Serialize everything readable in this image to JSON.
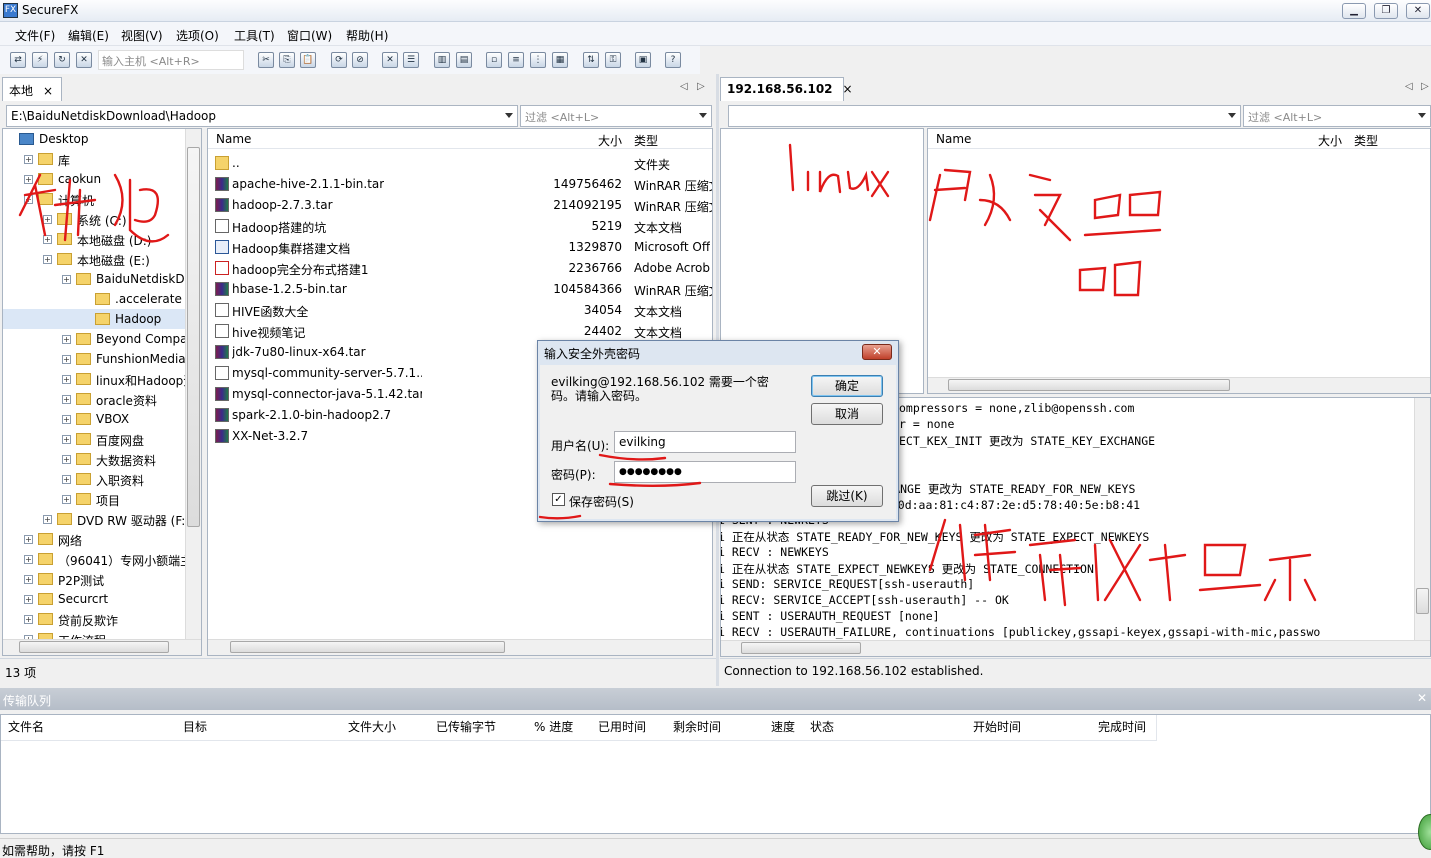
{
  "window": {
    "title": "SecureFX",
    "min": "▁",
    "max": "❐",
    "close": "✕"
  },
  "menu": [
    "文件(F)",
    "编辑(E)",
    "视图(V)",
    "选项(O)",
    "工具(T)",
    "窗口(W)",
    "帮助(H)"
  ],
  "toolbar": {
    "host_placeholder": "输入主机 <Alt+R>"
  },
  "left": {
    "tab_label": "本地",
    "tab_close": "×",
    "path": "E:\\BaiduNetdiskDownload\\Hadoop",
    "filter_placeholder": "过滤 <Alt+L>",
    "tree": [
      {
        "label": "Desktop",
        "indent": 0
      },
      {
        "label": "库",
        "indent": 1
      },
      {
        "label": "caokun",
        "indent": 1
      },
      {
        "label": "计算机",
        "indent": 1
      },
      {
        "label": "系统 (C:)",
        "indent": 2
      },
      {
        "label": "本地磁盘 (D:)",
        "indent": 2
      },
      {
        "label": "本地磁盘 (E:)",
        "indent": 2
      },
      {
        "label": "BaiduNetdiskDow",
        "indent": 3
      },
      {
        "label": ".accelerate",
        "indent": 4
      },
      {
        "label": "Hadoop",
        "indent": 4
      },
      {
        "label": "Beyond Compare",
        "indent": 3
      },
      {
        "label": "FunshionMedia",
        "indent": 3
      },
      {
        "label": "linux和Hadoop资料",
        "indent": 3
      },
      {
        "label": "oracle资料",
        "indent": 3
      },
      {
        "label": "VBOX",
        "indent": 3
      },
      {
        "label": "百度网盘",
        "indent": 3
      },
      {
        "label": "大数据资料",
        "indent": 3
      },
      {
        "label": "入职资料",
        "indent": 3
      },
      {
        "label": "项目",
        "indent": 3
      },
      {
        "label": "DVD RW 驱动器 (F:)",
        "indent": 2
      },
      {
        "label": "网络",
        "indent": 1
      },
      {
        "label": "（96041）专网小额端主机",
        "indent": 1
      },
      {
        "label": "P2P测试",
        "indent": 1
      },
      {
        "label": "Securcrt",
        "indent": 1
      },
      {
        "label": "贷前反欺诈",
        "indent": 1
      },
      {
        "label": "工作流程",
        "indent": 1
      }
    ],
    "columns": {
      "name": "Name",
      "size": "大小",
      "type": "类型"
    },
    "files": [
      {
        "name": "..",
        "size": "",
        "type": "文件夹",
        "icon": "folder"
      },
      {
        "name": "apache-hive-2.1.1-bin.tar",
        "size": "149756462",
        "type": "WinRAR 压缩文",
        "icon": "rar"
      },
      {
        "name": "hadoop-2.7.3.tar",
        "size": "214092195",
        "type": "WinRAR 压缩文",
        "icon": "rar"
      },
      {
        "name": "Hadoop搭建的坑",
        "size": "5219",
        "type": "文本文档",
        "icon": "doc"
      },
      {
        "name": "Hadoop集群搭建文档",
        "size": "1329870",
        "type": "Microsoft Off",
        "icon": "word"
      },
      {
        "name": "hadoop完全分布式搭建1",
        "size": "2236766",
        "type": "Adobe Acrob",
        "icon": "pdf"
      },
      {
        "name": "hbase-1.2.5-bin.tar",
        "size": "104584366",
        "type": "WinRAR 压缩文",
        "icon": "rar"
      },
      {
        "name": "HIVE函数大全",
        "size": "34054",
        "type": "文本文档",
        "icon": "doc"
      },
      {
        "name": "hive视频笔记",
        "size": "24402",
        "type": "文本文档",
        "icon": "doc"
      },
      {
        "name": "jdk-7u80-linux-x64.tar",
        "size": "",
        "type": "",
        "icon": "rar"
      },
      {
        "name": "mysql-community-server-5.7.1...",
        "size": "",
        "type": "",
        "icon": "doc"
      },
      {
        "name": "mysql-connector-java-5.1.42.tar",
        "size": "",
        "type": "",
        "icon": "rar"
      },
      {
        "name": "spark-2.1.0-bin-hadoop2.7",
        "size": "",
        "type": "",
        "icon": "rar"
      },
      {
        "name": "XX-Net-3.2.7",
        "size": "",
        "type": "",
        "icon": "rar"
      }
    ],
    "status": "13 项"
  },
  "right": {
    "tab_label": "192.168.56.102",
    "tab_close": "×",
    "filter_placeholder": "过滤 <Alt+L>",
    "columns": {
      "name": "Name",
      "size": "大小",
      "type": "类型"
    },
    "log": [
      "i 正在从状态 STATE_EXPECT_KEX_INIT 更改为 STATE_KEY_EXCHANGE",
      "i 正在从状态 STATE_KEY_EXCHANGE 更改为 STATE_READY_FOR_NEW_KEYS",
      "i 主机密钥指纹: 45:98:f7:56:0d:aa:81:c4:87:2e:d5:78:40:5e:b8:41",
      "i SENT : NEWKEYS",
      "i 正在从状态 STATE_READY_FOR_NEW_KEYS 更改为 STATE_EXPECT_NEWKEYS",
      "i RECV : NEWKEYS",
      "i 正在从状态 STATE_EXPECT_NEWKEYS 更改为 STATE_CONNECTION",
      "i SEND: SERVICE_REQUEST[ssh-userauth]",
      "i RECV: SERVICE_ACCEPT[ssh-userauth] -- OK",
      "i SENT : USERAUTH_REQUEST [none]",
      "i RECV : USERAUTH_FAILURE, continuations [publickey,gssapi-keyex,gssapi-with-mic,passwo"
    ],
    "log_head": [
      "ompressors = none,zlib@openssh.com",
      "r = none",
      "ECT_KEX_INIT 更改为 STATE_KEY_EXCHANGE"
    ],
    "status": "Connection to 192.168.56.102 established."
  },
  "queue": {
    "title": "传输队列",
    "columns": [
      "文件名",
      "目标",
      "文件大小",
      "已传输字节",
      "% 进度",
      "已用时间",
      "剩余时间",
      "速度",
      "状态",
      "开始时间",
      "完成时间"
    ]
  },
  "statusbar": "如需帮助，请按 F1",
  "dialog": {
    "title": "输入安全外壳密码",
    "message": "evilking@192.168.56.102 需要一个密码。请输入密码。",
    "username_label": "用户名(U):",
    "username": "evilking",
    "password_label": "密码(P):",
    "password": "●●●●●●●●",
    "save_password": "保存密码(S)",
    "ok": "确定",
    "cancel": "取消",
    "skip": "跳过(K)"
  }
}
